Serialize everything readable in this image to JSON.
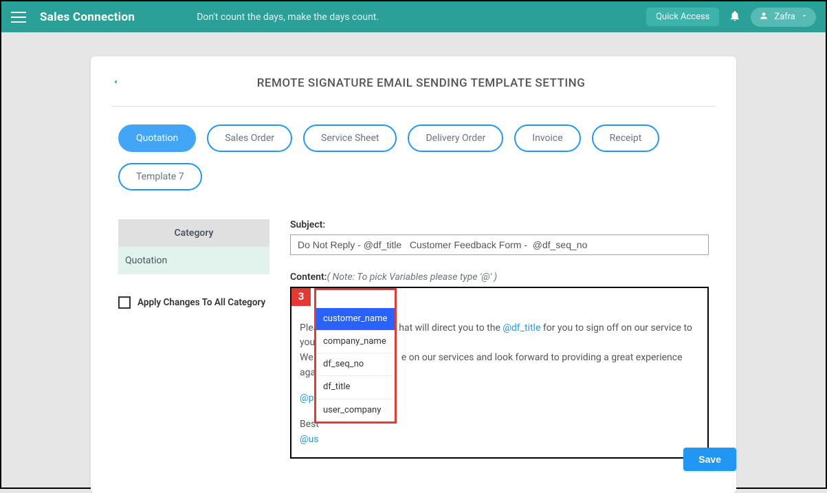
{
  "topbar": {
    "brand": "Sales Connection",
    "slogan": "Don't count the days, make the days count.",
    "quick_access": "Quick Access",
    "user_name": "Zafra"
  },
  "page": {
    "title": "REMOTE SIGNATURE EMAIL SENDING TEMPLATE SETTING"
  },
  "tabs": [
    {
      "label": "Quotation",
      "active": true
    },
    {
      "label": "Sales Order",
      "active": false
    },
    {
      "label": "Service Sheet",
      "active": false
    },
    {
      "label": "Delivery Order",
      "active": false
    },
    {
      "label": "Invoice",
      "active": false
    },
    {
      "label": "Receipt",
      "active": false
    },
    {
      "label": "Template 7",
      "active": false
    }
  ],
  "sidebar": {
    "category_header": "Category",
    "items": [
      {
        "label": "Quotation"
      }
    ],
    "apply_all_label": "Apply Changes To All Category"
  },
  "form": {
    "subject_label": "Subject:",
    "subject_value": "Do Not Reply - @df_title   Customer Feedback Form -  @df_seq_no",
    "content_label": "Content:",
    "content_note": "( Note: To pick Variables please type '@' )",
    "at_typed": "@",
    "body_line2_prefix": "Plea",
    "body_line2_mid": "hat will direct you to the ",
    "body_line2_var": "@df_title",
    "body_line2_suffix": " for you to sign off on our service to you.",
    "body_line3_prefix": "We a",
    "body_line3_suffix": "e on our services and look forward to providing a great experience again.",
    "body_line5_var": "@pu",
    "body_line7": "Best",
    "body_line8_var": "@us"
  },
  "dropdown": {
    "marker": "3",
    "items": [
      {
        "label": "customer_name",
        "selected": true
      },
      {
        "label": "company_name",
        "selected": false
      },
      {
        "label": "df_seq_no",
        "selected": false
      },
      {
        "label": "df_title",
        "selected": false
      },
      {
        "label": "user_company",
        "selected": false
      }
    ]
  },
  "actions": {
    "save_label": "Save"
  }
}
